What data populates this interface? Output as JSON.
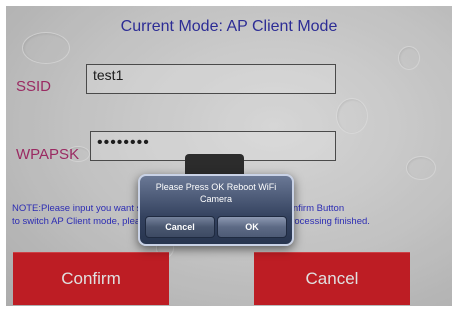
{
  "header": {
    "mode_title": "Current Mode: AP Client Mode"
  },
  "form": {
    "ssid_label": "SSID",
    "ssid_value": "test1",
    "wpapsk_label": "WPAPSK",
    "wpapsk_value": "••••••••"
  },
  "note": {
    "line1": "NOTE:Please input you want switch SSID&Password, and click Confirm Button",
    "line2": "to switch AP Client mode, please don't power off the router when processing finished."
  },
  "buttons": {
    "confirm_label": "Confirm",
    "cancel_label": "Cancel"
  },
  "alert": {
    "message": "Please Press OK Reboot WiFi Camera",
    "cancel_label": "Cancel",
    "ok_label": "OK"
  }
}
